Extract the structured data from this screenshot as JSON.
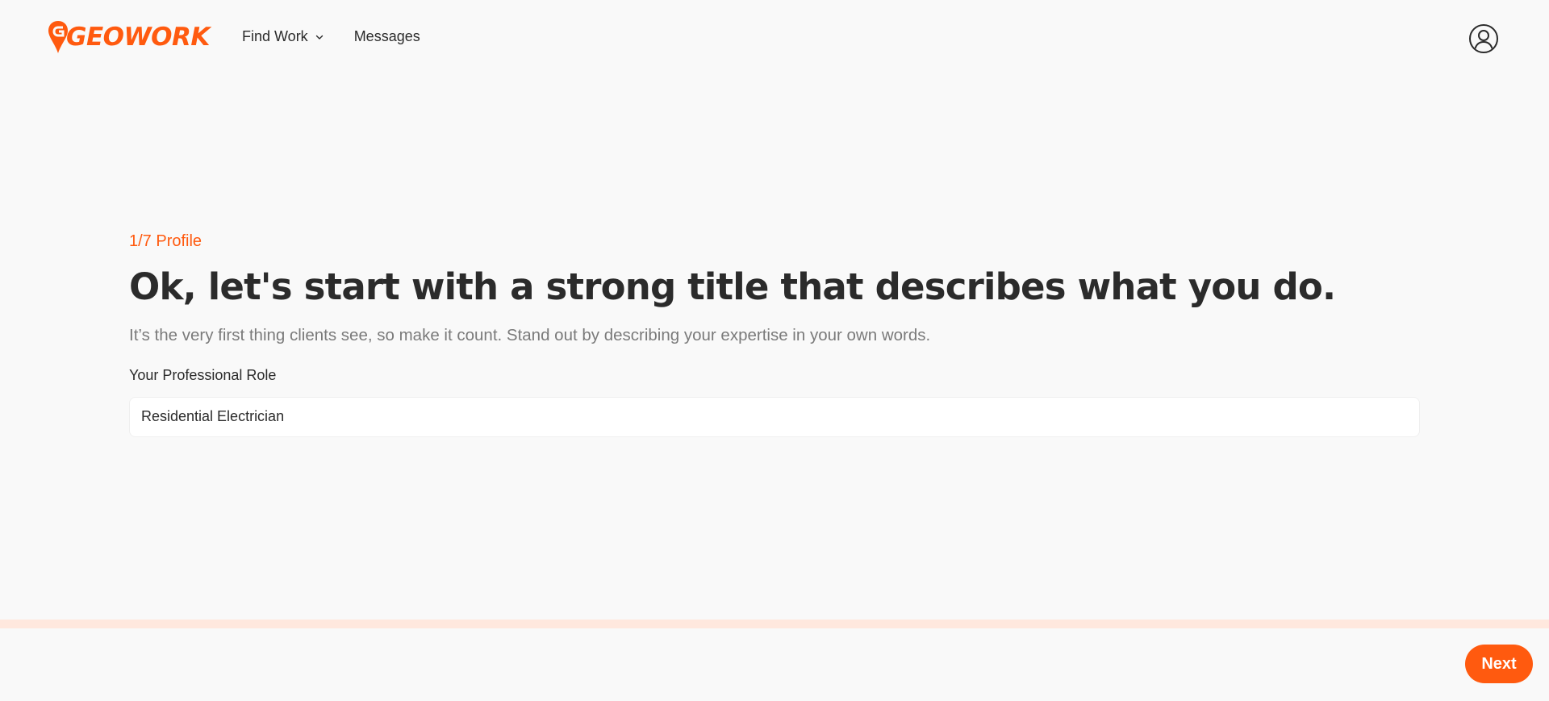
{
  "brand": {
    "name": "GEOWORK",
    "accent_color": "#ff5a0f",
    "logo_icon": "map-pin-icon"
  },
  "nav": {
    "items": [
      {
        "label": "Find Work",
        "has_dropdown": true,
        "icon": "chevron-down-icon"
      },
      {
        "label": "Messages",
        "has_dropdown": false
      }
    ]
  },
  "header": {
    "profile_icon": "user-circle-icon"
  },
  "main": {
    "step": "1/7 Profile",
    "title": "Ok, let's start with a strong title that describes what you do.",
    "subtitle": "It’s the very first thing clients see, so make it count. Stand out by describing your expertise in your own words.",
    "field_label": "Your Professional Role",
    "field_value": "Residential Electrician"
  },
  "progress": {
    "current_step": 1,
    "total_steps": 7,
    "fill_fraction": 0
  },
  "footer": {
    "next_label": "Next"
  }
}
